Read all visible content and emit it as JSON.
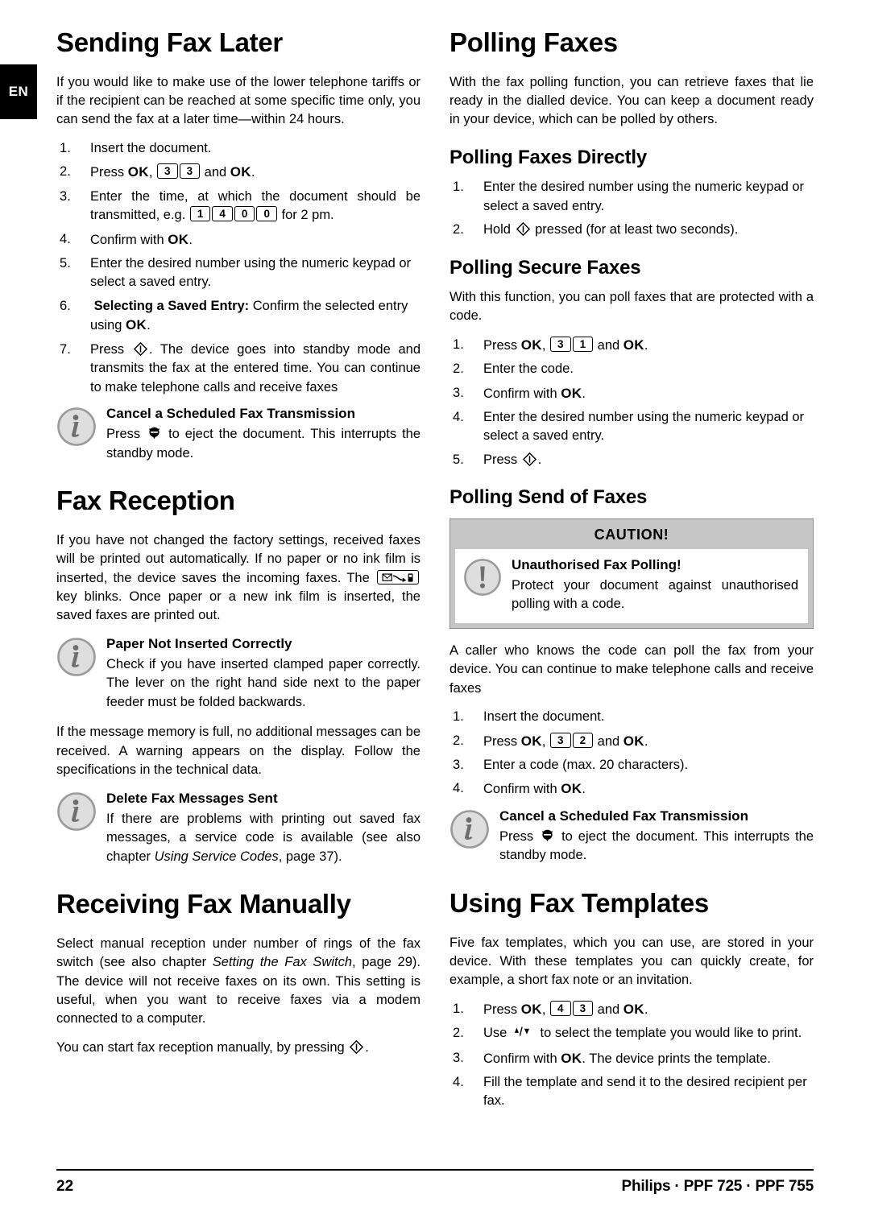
{
  "language_tab": "EN",
  "footer": {
    "page_number": "22",
    "brand": "Philips · PPF 725 · PPF 755"
  },
  "left_column": {
    "sending_fax_later": {
      "heading": "Sending Fax Later",
      "intro": "If you would like to make use of the lower telephone tariffs or if the recipient can be reached at some specific time only, you can send the fax at a later time—within 24 hours.",
      "step1": "Insert the document.",
      "step2_pre": "Press ",
      "step2_ok1": "OK",
      "step2_comma": ", ",
      "step2_key1": "3",
      "step2_key2": "3",
      "step2_mid": " and ",
      "step2_ok2": "OK",
      "step2_end": ".",
      "step3_pre": "Enter the time, at which the document should be transmitted, e.g. ",
      "step3_key1": "1",
      "step3_key2": "4",
      "step3_key3": "0",
      "step3_key4": "0",
      "step3_end": " for 2 pm.",
      "step4_pre": "Confirm with ",
      "step4_ok": "OK",
      "step4_end": ".",
      "step5": "Enter the desired number using the numeric keypad or select a saved entry.",
      "step6_bold": "Selecting a Saved Entry:",
      "step6_mid": " Confirm the selected entry using ",
      "step6_ok": "OK",
      "step6_end": ".",
      "step7_pre": "Press ",
      "step7_end": ". The device goes into standby mode and transmits the fax at the entered time. You can continue to make telephone calls and receive faxes",
      "note_title": "Cancel a Scheduled Fax Transmission",
      "note_pre": "Press ",
      "note_end": " to eject the document. This interrupts the standby mode."
    },
    "fax_reception": {
      "heading": "Fax Reception",
      "para1_a": "If you have not changed the factory settings, received faxes will be printed out automatically. If no paper or no ink film is inserted, the device saves the incoming faxes. The ",
      "para1_b": " key blinks. Once paper or a new ink film is inserted, the saved faxes are printed out.",
      "note1_title": "Paper Not Inserted Correctly",
      "note1_text": "Check if you have inserted clamped paper correctly. The lever on the right hand side next to the paper feeder must be folded backwards.",
      "para2": "If the message memory is full, no additional messages can be received. A warning appears on the display. Follow the specifications in the technical data.",
      "note2_title": "Delete Fax Messages Sent",
      "note2_a": "If there are problems with printing out saved fax messages, a service code is available (see also chapter ",
      "note2_italic": "Using Service Codes",
      "note2_b": ", page 37)."
    },
    "receiving_fax_manually": {
      "heading": "Receiving Fax Manually",
      "para1_a": "Select manual reception under number of rings of the fax switch (see also chapter ",
      "para1_italic": "Setting the Fax Switch",
      "para1_b": ", page 29). The device will not receive faxes on its own. This setting is useful, when you want to receive faxes via a modem connected to a computer.",
      "para2_pre": "You can start fax reception manually, by pressing ",
      "para2_end": "."
    }
  },
  "right_column": {
    "polling_faxes": {
      "heading": "Polling Faxes",
      "intro": "With the fax polling function, you can retrieve faxes that lie ready in the dialled device. You can keep a document ready in your device, which can be polled by others."
    },
    "polling_faxes_directly": {
      "heading": "Polling Faxes Directly",
      "step1": "Enter the desired number using the numeric keypad or select a saved entry.",
      "step2_pre": "Hold ",
      "step2_end": " pressed (for at least two seconds)."
    },
    "polling_secure_faxes": {
      "heading": "Polling Secure Faxes",
      "intro": "With this function, you can poll faxes that are protected with a code.",
      "step1_pre": "Press ",
      "step1_ok1": "OK",
      "step1_comma": ", ",
      "step1_key1": "3",
      "step1_key2": "1",
      "step1_mid": " and ",
      "step1_ok2": "OK",
      "step1_end": ".",
      "step2": "Enter the code.",
      "step3_pre": "Confirm with ",
      "step3_ok": "OK",
      "step3_end": ".",
      "step4": "Enter the desired number using the numeric keypad or select a saved entry.",
      "step5_pre": "Press ",
      "step5_end": "."
    },
    "polling_send_of_faxes": {
      "heading": "Polling Send of Faxes",
      "caution_header": "CAUTION!",
      "caution_title": "Unauthorised Fax Polling!",
      "caution_text": "Protect your document against unauthorised polling with a code.",
      "para": "A caller who knows the code can poll the fax from your device. You can continue to make telephone calls and receive faxes",
      "step1": "Insert the document.",
      "step2_pre": "Press ",
      "step2_ok1": "OK",
      "step2_comma": ", ",
      "step2_key1": "3",
      "step2_key2": "2",
      "step2_mid": " and ",
      "step2_ok2": "OK",
      "step2_end": ".",
      "step3": "Enter a code (max. 20 characters).",
      "step4_pre": "Confirm with ",
      "step4_ok": "OK",
      "step4_end": ".",
      "note_title": "Cancel a Scheduled Fax Transmission",
      "note_pre": "Press ",
      "note_end": " to eject the document. This interrupts the standby mode."
    },
    "using_fax_templates": {
      "heading": "Using Fax Templates",
      "intro": "Five fax templates, which you can use, are stored in your device. With these templates you can quickly create, for example, a short fax note or an invitation.",
      "step1_pre": "Press ",
      "step1_ok1": "OK",
      "step1_comma": ", ",
      "step1_key1": "4",
      "step1_key2": "3",
      "step1_mid": " and ",
      "step1_ok2": "OK",
      "step1_end": ".",
      "step2_pre": "Use ",
      "step2_end": " to select the template you would like to print.",
      "step3_pre": "Confirm with ",
      "step3_ok": "OK",
      "step3_end": ". The device prints the template.",
      "step4": "Fill the template and send it to the desired recipient per fax."
    }
  },
  "icons": {
    "info": "info-icon",
    "caution": "caution-icon",
    "start": "start-key-icon",
    "stop": "stop-key-icon",
    "fax_key": "fax-key-icon",
    "updown": "up-down-arrows-icon"
  },
  "colors": {
    "caution_frame": "#c6c6c6",
    "icon_gray": "#9b9b9b",
    "icon_fill": "#d9d9d9"
  }
}
